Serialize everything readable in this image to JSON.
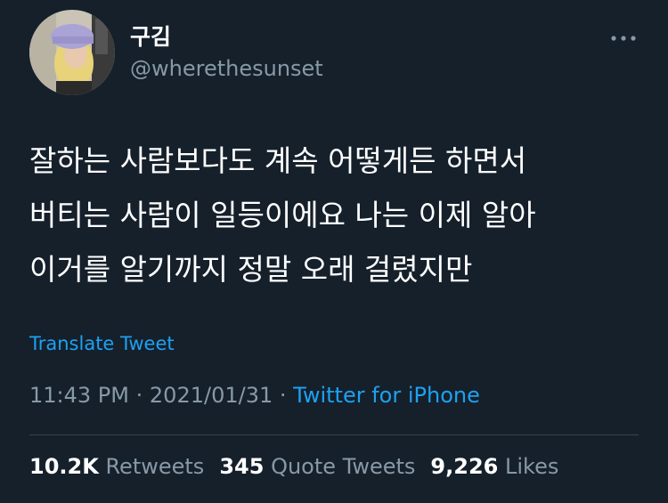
{
  "tweet": {
    "author": {
      "display_name": "구김",
      "handle": "@wherethesunset"
    },
    "text_lines": [
      "잘하는 사람보다도 계속 어떻게든 하면서",
      "버티는 사람이 일등이에요 나는 이제 알아",
      "이거를 알기까지 정말 오래 걸렸지만"
    ],
    "translate_label": "Translate Tweet",
    "time": "11:43 PM",
    "separator": "·",
    "date": "2021/01/31",
    "source": "Twitter for iPhone",
    "stats": {
      "retweets_count": "10.2K",
      "retweets_label": "Retweets",
      "quote_count": "345",
      "quote_label": "Quote Tweets",
      "likes_count": "9,226",
      "likes_label": "Likes"
    }
  },
  "colors": {
    "background": "#15202b",
    "text_primary": "#ffffff",
    "text_secondary": "#8899a6",
    "accent": "#1da1f2",
    "divider": "#38444d"
  },
  "icons": {
    "more": "more-horizontal-icon"
  }
}
